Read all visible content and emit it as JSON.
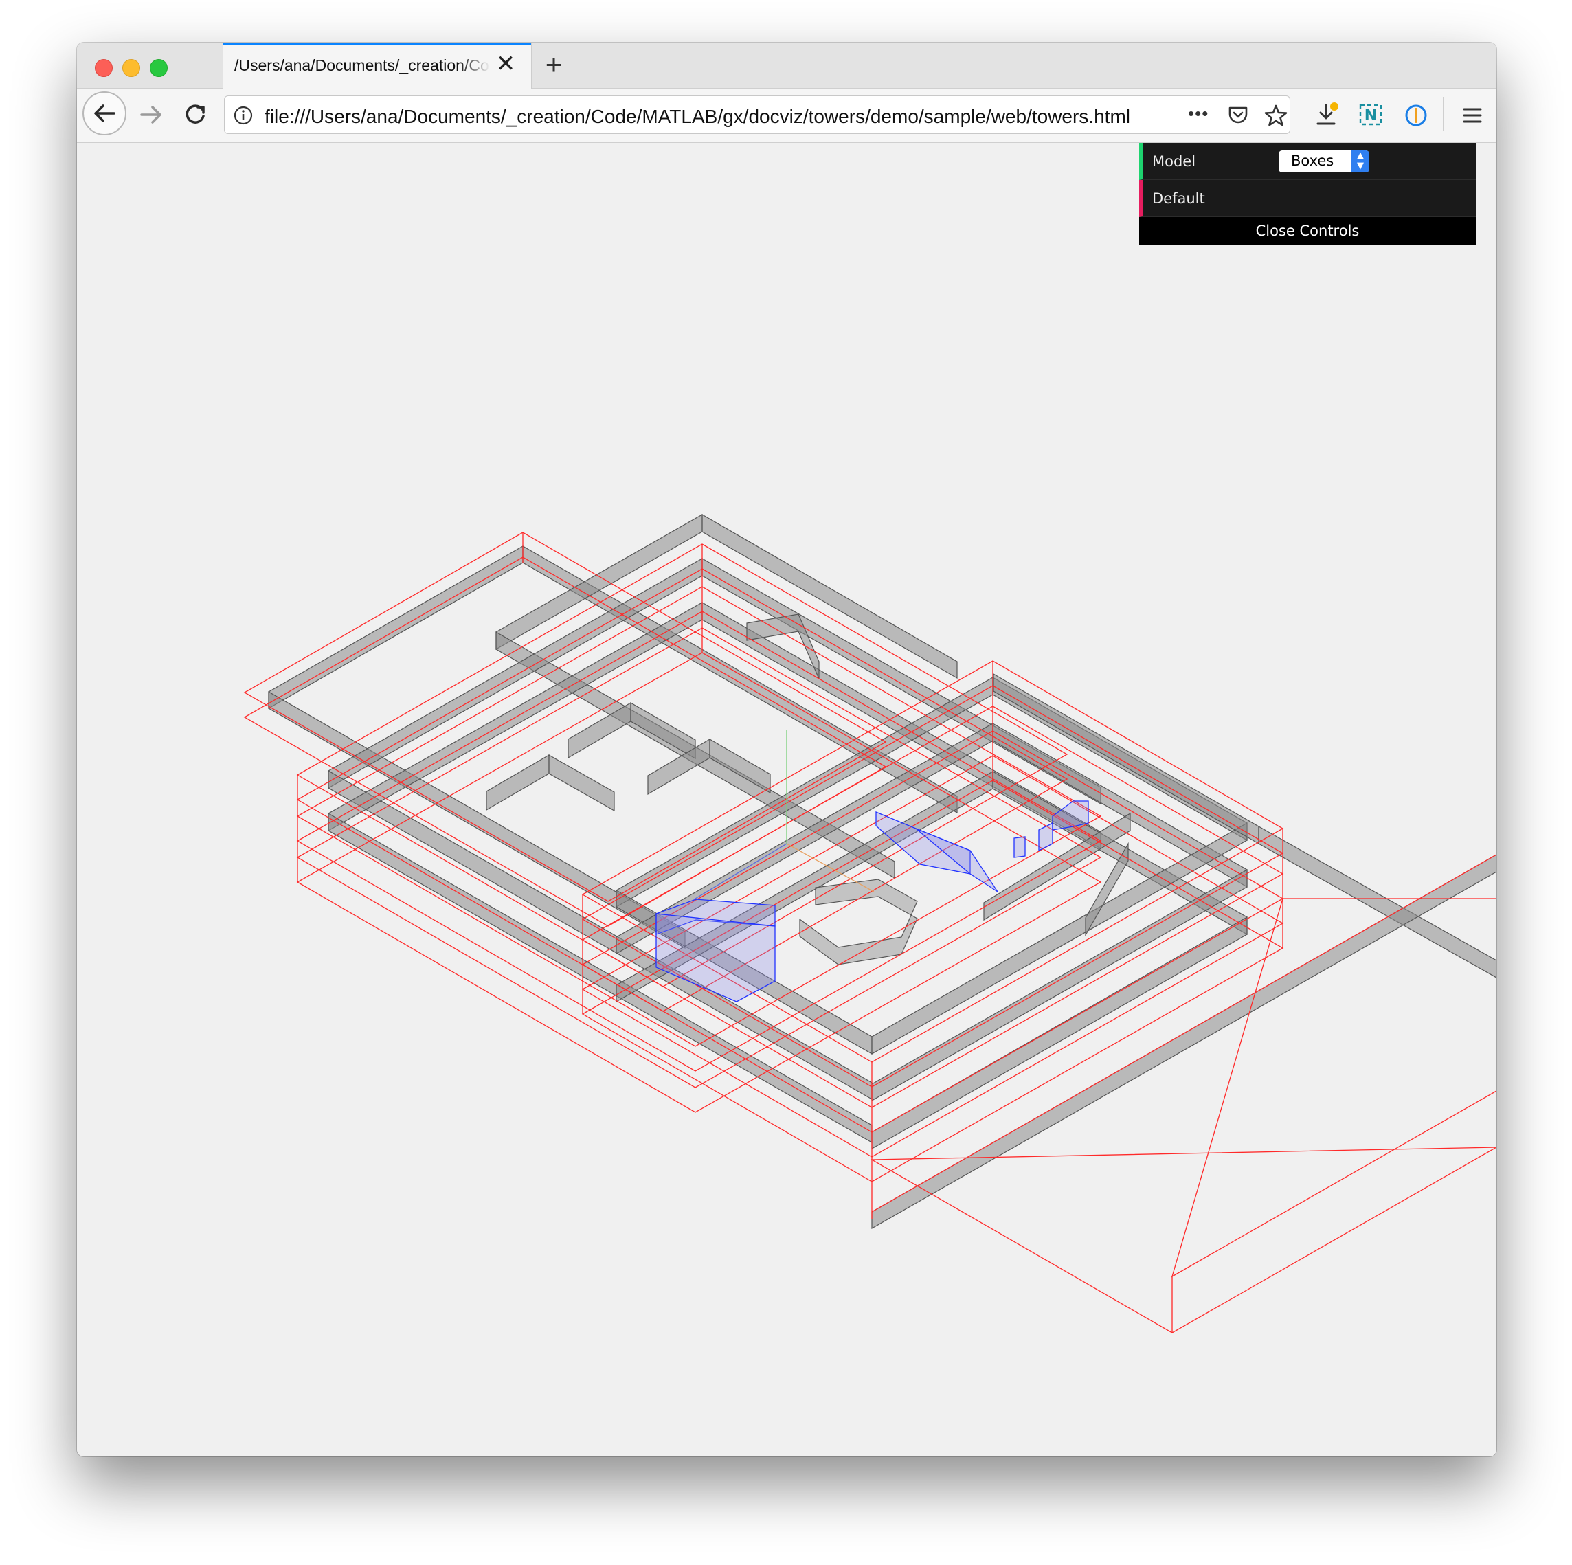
{
  "browser": {
    "tab_title": "/Users/ana/Documents/_creation/Code/MATLAB/gx/docviz/towers/demo/sample/web/towers.html",
    "new_tab_glyph": "+",
    "close_tab_glyph": "✕",
    "url": "file:///Users/ana/Documents/_creation/Code/MATLAB/gx/docviz/towers/demo/sample/web/towers.html",
    "more_glyph": "•••",
    "menu_glyph": "☰",
    "icons": [
      "back-arrow-icon",
      "forward-arrow-icon",
      "reload-icon",
      "info-icon",
      "pocket-icon",
      "star-icon",
      "download-icon",
      "extension-icon",
      "onepassword-icon",
      "hamburger-menu-icon"
    ]
  },
  "controls": {
    "model_label": "Model",
    "model_value": "Boxes",
    "default_label": "Default",
    "close_label": "Close Controls",
    "colors": {
      "model_accent": "#1ed36f",
      "default_accent": "#e61d5f",
      "select_button": "#2f7ff0"
    }
  },
  "scene": {
    "description_colors": {
      "wireframe": "#ff2a2a",
      "solid_faces": "#9a9a9a",
      "highlight": "#2233ff"
    }
  }
}
